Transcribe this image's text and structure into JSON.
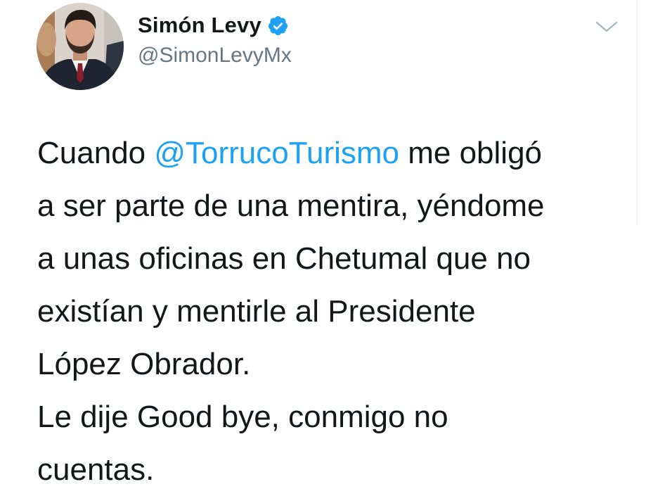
{
  "tweet": {
    "author": {
      "display_name": "Simón Levy",
      "handle": "@SimonLevyMx",
      "verified": true
    },
    "icons": {
      "verified": "verified-badge-icon",
      "menu": "chevron-down-icon"
    },
    "text": {
      "line1_before": "Cuando ",
      "mention": "@TorrucoTurismo",
      "line1_after": " me obligó",
      "line2": "a ser parte de una mentira, yéndome",
      "line3": "a unas oficinas en Chetumal que no",
      "line4": "existían y mentirle al Presidente",
      "line5": "López Obrador.",
      "line6": "Le dije Good bye, conmigo no",
      "line7": "cuentas."
    },
    "colors": {
      "mention": "#1da1f2",
      "verified_badge": "#1da1f2",
      "handle": "#657786",
      "text": "#14171a"
    }
  }
}
